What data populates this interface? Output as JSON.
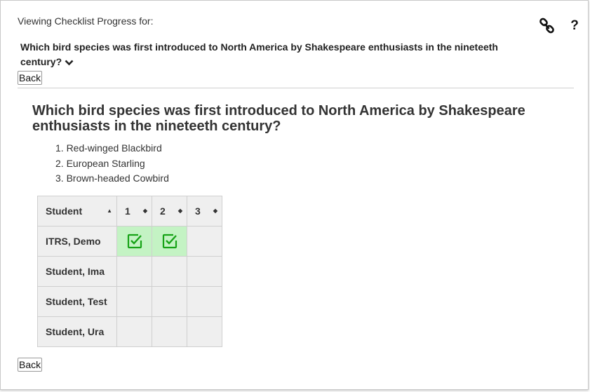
{
  "header": {
    "viewing_label": "Viewing Checklist Progress for:",
    "selected_question": "Which bird species was first introduced to North America by Shakespeare enthusiasts in the nineteeth century?"
  },
  "toolbar": {
    "link_icon": "link-icon",
    "help_icon": "help-icon",
    "help_glyph": "?"
  },
  "back_label": "Back",
  "question": {
    "title": "Which bird species was first introduced to North America by Shakespeare enthusiasts in the nineteeth century?",
    "answers": [
      "1. Red-winged Blackbird",
      "2. European Starling",
      "3. Brown-headed Cowbird"
    ]
  },
  "table": {
    "headers": [
      "Student",
      "1",
      "2",
      "3"
    ],
    "sort_glyph_student": "▲",
    "sort_glyph": "◆",
    "rows": [
      {
        "name": "ITRS, Demo",
        "cells": [
          true,
          true,
          false
        ]
      },
      {
        "name": "Student, Ima",
        "cells": [
          false,
          false,
          false
        ]
      },
      {
        "name": "Student, Test",
        "cells": [
          false,
          false,
          false
        ]
      },
      {
        "name": "Student, Ura",
        "cells": [
          false,
          false,
          false
        ]
      }
    ],
    "done_color": "#c4f3c4",
    "check_color": "#17a317"
  }
}
